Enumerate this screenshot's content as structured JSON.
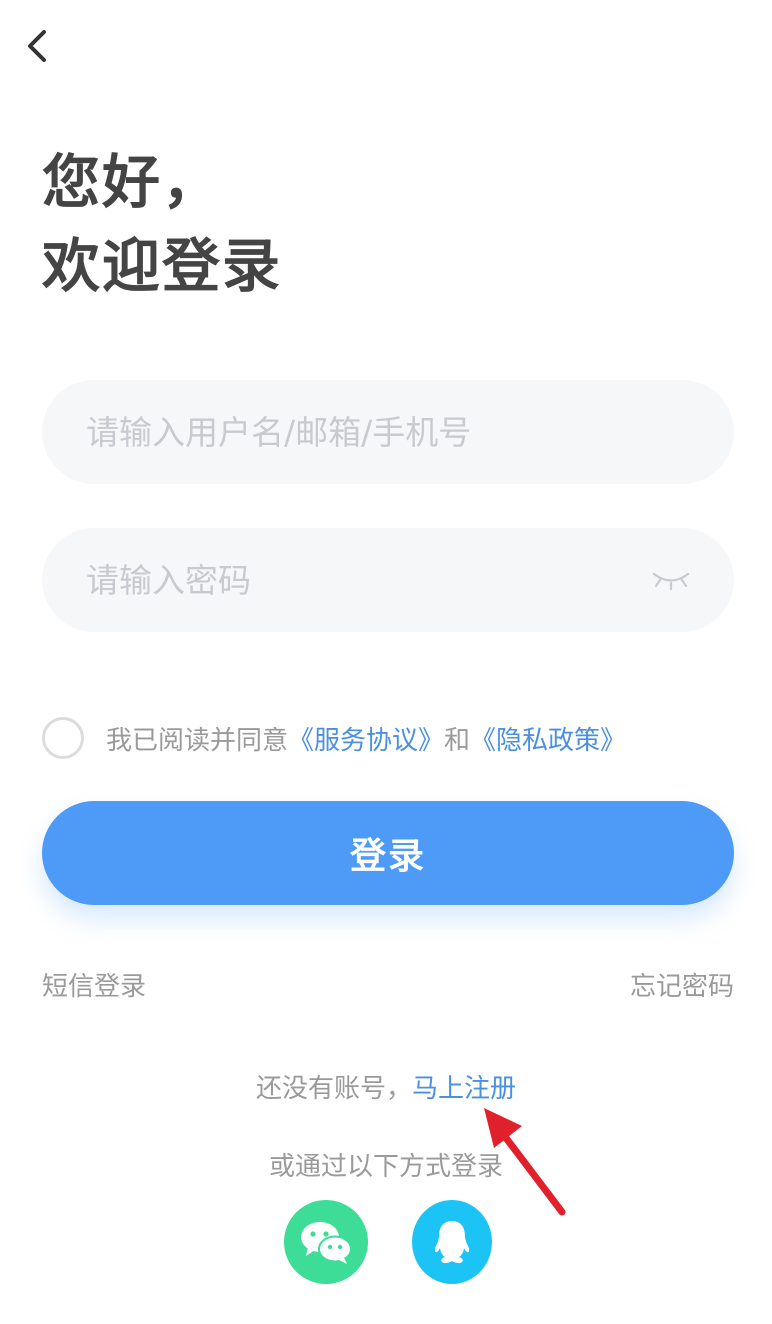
{
  "nav": {
    "back_icon": "chevron-left-icon"
  },
  "greeting": {
    "line1": "您好，",
    "line2": "欢迎登录"
  },
  "form": {
    "username_placeholder": "请输入用户名/邮箱/手机号",
    "username_value": "",
    "password_placeholder": "请输入密码",
    "password_value": "",
    "eye_icon": "eye-closed-icon"
  },
  "agreement": {
    "checked": false,
    "prefix": "我已阅读并同意",
    "service_link": "《服务协议》",
    "conjunction": "和",
    "privacy_link": "《隐私政策》"
  },
  "login_button": "登录",
  "links": {
    "sms_login": "短信登录",
    "forgot_password": "忘记密码"
  },
  "register": {
    "prompt": "还没有账号，",
    "link": "马上注册"
  },
  "other_login": {
    "label": "或通过以下方式登录",
    "providers": [
      {
        "icon": "wechat-icon",
        "color": "#3ddc97"
      },
      {
        "icon": "qq-icon",
        "color": "#1cc4f6"
      }
    ]
  },
  "colors": {
    "accent": "#4d9bf7",
    "link": "#4a90e2",
    "annotation_arrow": "#e0202a"
  }
}
